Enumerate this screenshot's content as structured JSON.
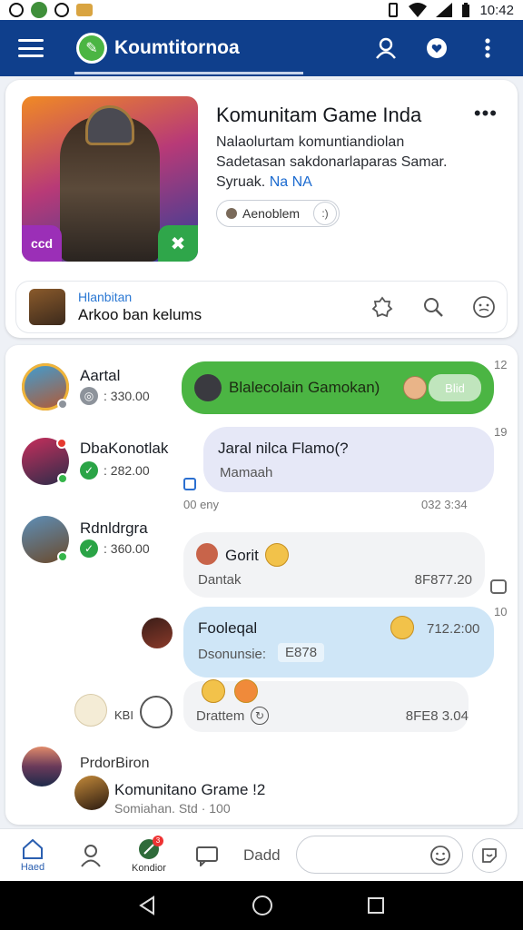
{
  "status_bar": {
    "time": "10:42"
  },
  "app_bar": {
    "brand_name": "Koumtitornoa"
  },
  "game": {
    "title": "Komunitam Game Inda",
    "description_line1": "Nalaolurtam komuntiandiolan",
    "description_line2": "Sadetasan sakdonarlaparas Samar.",
    "description_line3": "Syruak.",
    "description_tag": "Na NA",
    "follow_label": "Aenoblem",
    "cover_badge_left": "ccd"
  },
  "sub_bar": {
    "kicker": "Hlanbitan",
    "line": "Arkoo ban kelums"
  },
  "chat": {
    "users": [
      {
        "name": "Aartal",
        "meta": ": 330.00"
      },
      {
        "name": "DbaKonotlak",
        "meta": ": 282.00"
      },
      {
        "name": "Rdnldrgra",
        "meta": ": 360.00"
      }
    ],
    "bubble1": {
      "text": "Blalecolain Gamokan)",
      "pill": "Blid",
      "side_time": "12"
    },
    "bubble2": {
      "title": "Jaral nilca Flamo(?",
      "sub": "Mamaah",
      "side_time": "19"
    },
    "row2_left_stamp": "00 eny",
    "row2_right_stamp": "032 3:34",
    "bubble3": {
      "title": "Gorit",
      "sub": "Dantak",
      "stamp": "8F877.20"
    },
    "bubble4": {
      "title": "Fooleqal",
      "sub": "Dsonunsie:",
      "chip": "E878",
      "time": "712.2:00",
      "side_time": "10"
    },
    "bubble5": {
      "sub": "Drattem",
      "stamp": "8FE8 3.04",
      "count": "KBI"
    },
    "footer_user": {
      "name": "PrdorBiron",
      "title": "Komunitano Grame !2",
      "sub": "Somiahan. Std · 100"
    }
  },
  "bottom_nav": {
    "home_label": "Haed",
    "middle_label": "Kondior",
    "text_label": "Dadd",
    "badge": "3"
  }
}
